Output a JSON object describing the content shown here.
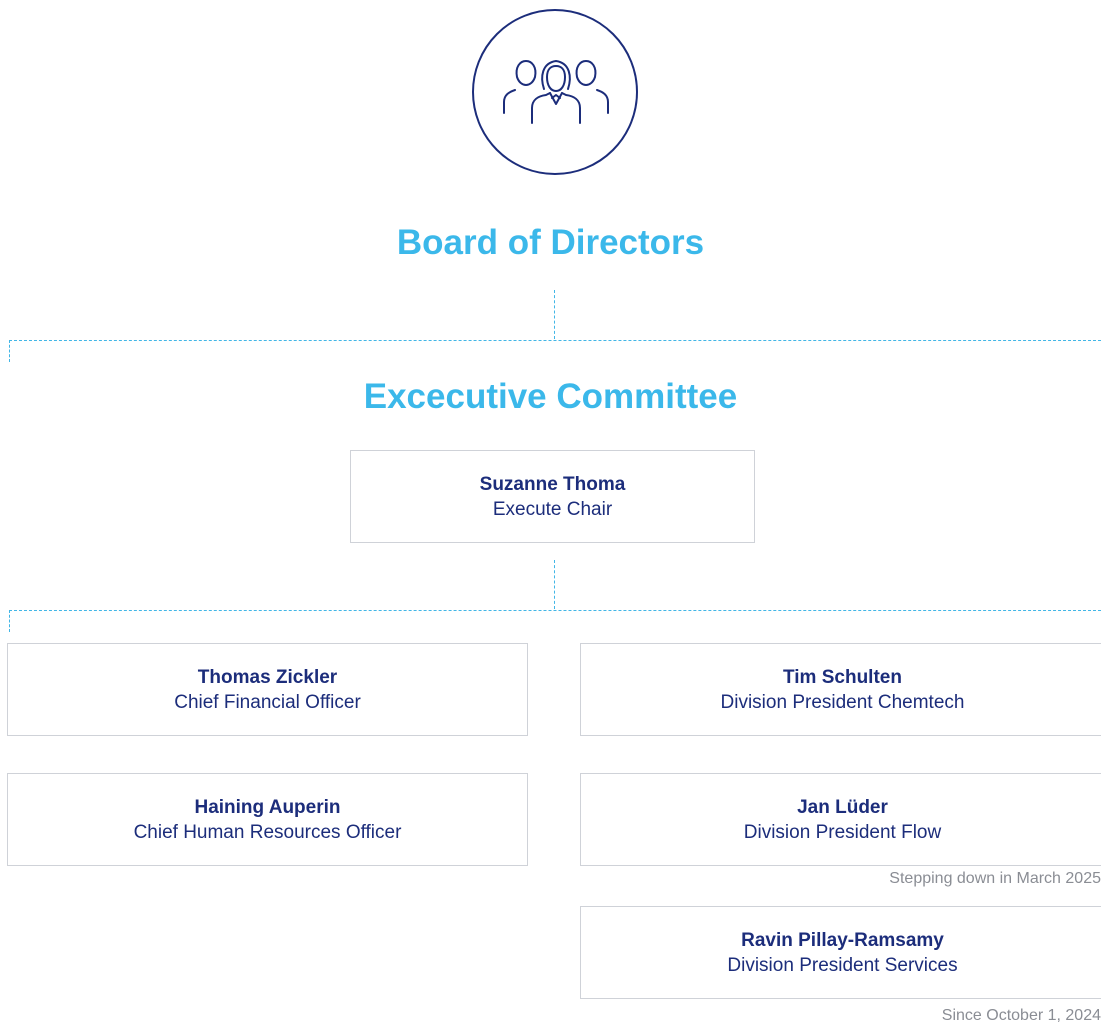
{
  "logo": {
    "icon": "team-icon",
    "color": "#1c2d7b"
  },
  "board": {
    "title": "Board of Directors"
  },
  "executive_committee": {
    "title": "Excecutive Committee",
    "chair": {
      "name": "Suzanne Thoma",
      "role": "Execute Chair"
    }
  },
  "members": [
    {
      "name": "Thomas Zickler",
      "role": "Chief Financial Officer"
    },
    {
      "name": "Tim Schulten",
      "role": "Division President Chemtech"
    },
    {
      "name": "Haining Auperin",
      "role": "Chief Human Resources Officer"
    },
    {
      "name": "Jan Lüder",
      "role": "Division President Flow",
      "note": "Stepping down in March 2025"
    },
    {
      "name": "Ravin Pillay-Ramsamy",
      "role": "Division President Services",
      "note": "Since October 1, 2024"
    }
  ],
  "colors": {
    "heading": "#3bb8ea",
    "text": "#1c2d7b",
    "connector": "#41b6e6",
    "card_border": "#cfd2d8",
    "note": "#8a8d94"
  }
}
